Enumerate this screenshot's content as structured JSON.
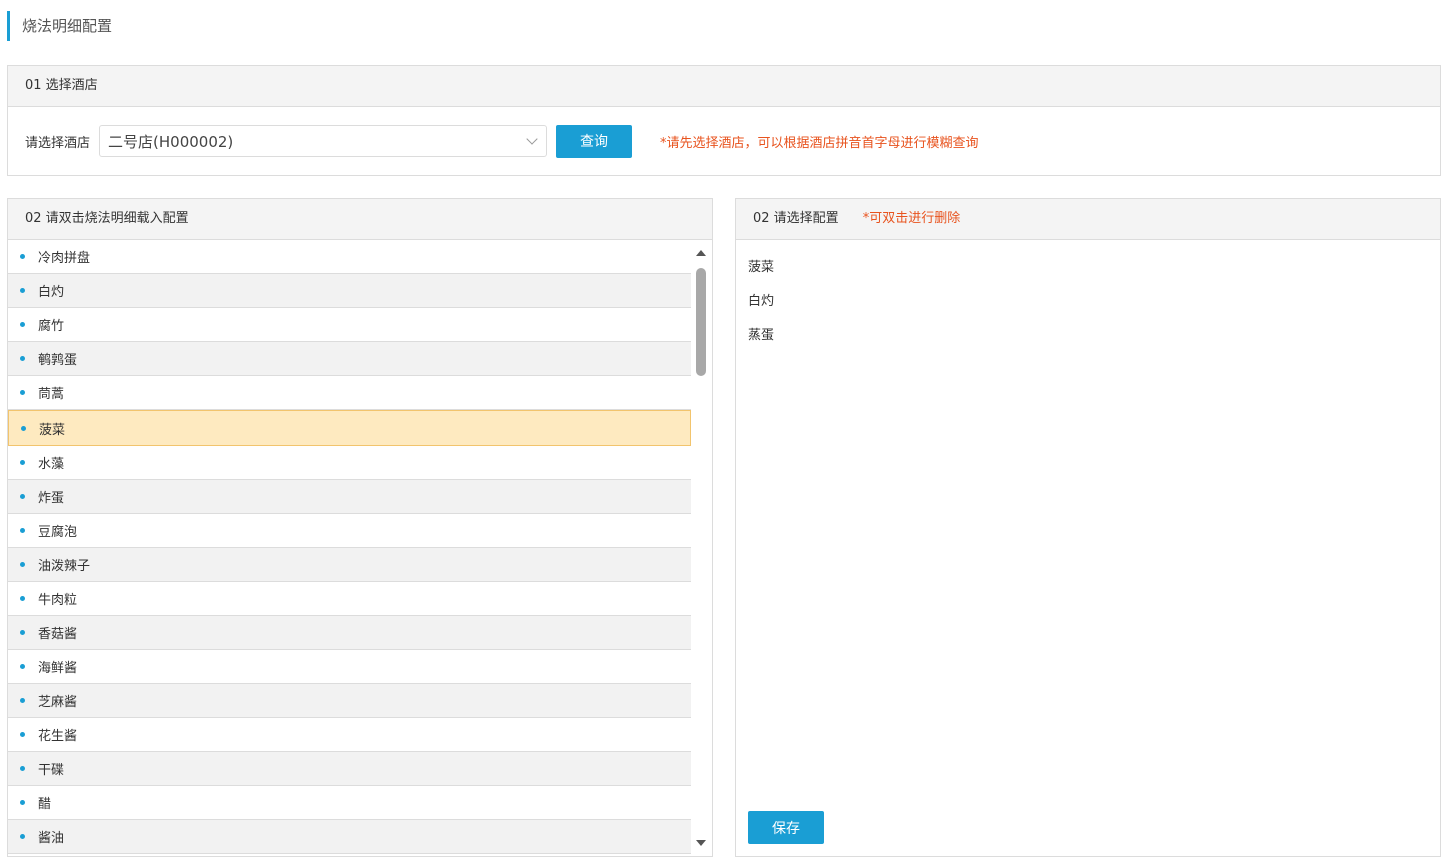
{
  "page": {
    "title": "烧法明细配置"
  },
  "hotel_section": {
    "header": "01 选择酒店",
    "label": "请选择酒店",
    "selected_hotel": "二号店(H000002)",
    "query_button": "查询",
    "hint": "*请先选择酒店，可以根据酒店拼音首字母进行模糊查询"
  },
  "detail_section": {
    "header": "02 请双击烧法明细载入配置",
    "items": [
      "冷肉拼盘",
      "白灼",
      "腐竹",
      "鹌鹑蛋",
      "茼蒿",
      "菠菜",
      "水藻",
      "炸蛋",
      "豆腐泡",
      "油泼辣子",
      "牛肉粒",
      "香菇酱",
      "海鲜酱",
      "芝麻酱",
      "花生酱",
      "干碟",
      "醋",
      "酱油"
    ],
    "selected_index": 5
  },
  "config_section": {
    "header": "02 请选择配置",
    "hint": "*可双击进行删除",
    "items": [
      "菠菜",
      "白灼",
      "蒸蛋"
    ],
    "save_button": "保存"
  },
  "colors": {
    "accent": "#1a9ed4",
    "warning": "#e8531e",
    "selected_bg": "#feeac0"
  }
}
